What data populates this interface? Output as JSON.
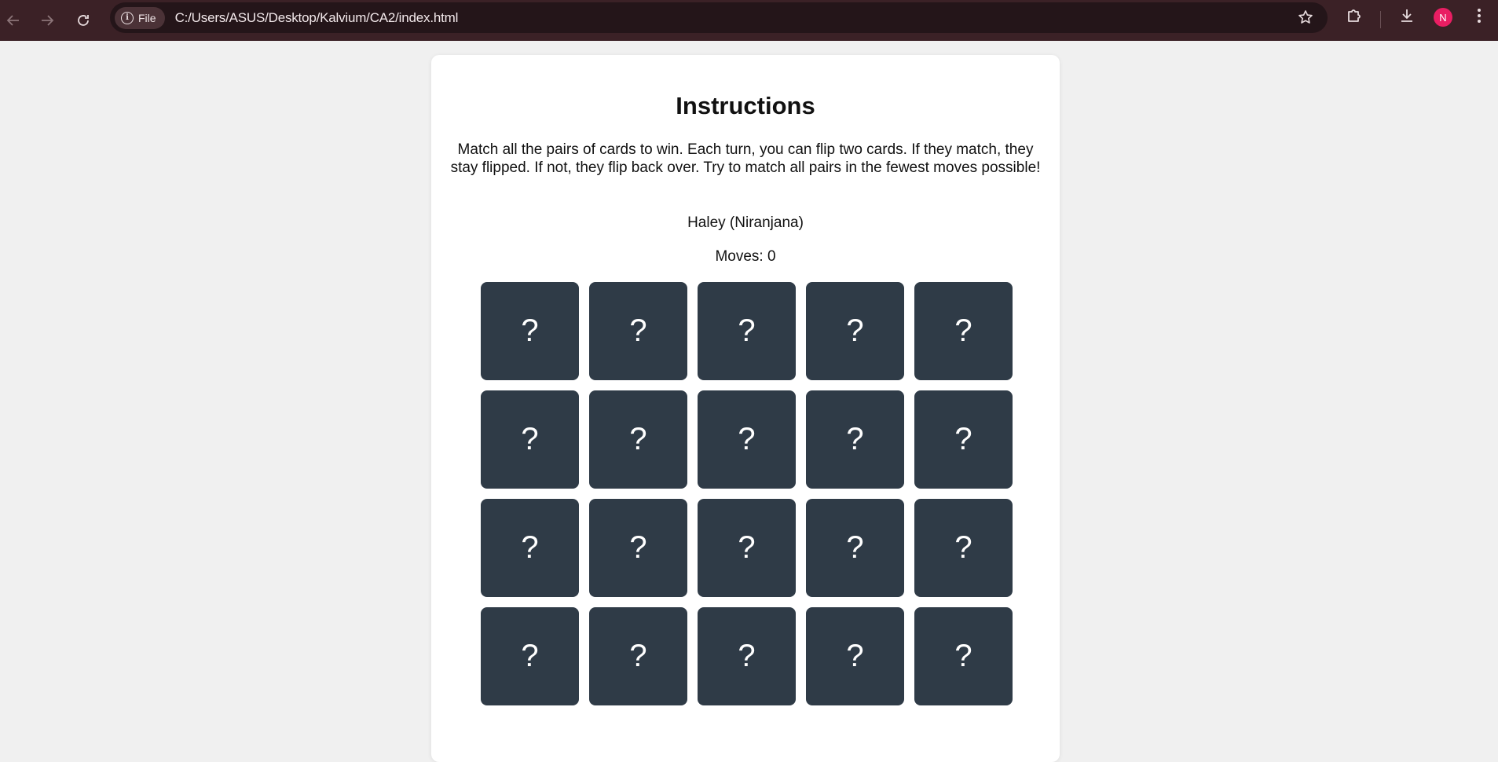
{
  "browser": {
    "chip_label": "File",
    "url": "C:/Users/ASUS/Desktop/Kalvium/CA2/index.html",
    "avatar_initial": "N",
    "toolbar_color": "#3b2126",
    "avatar_color": "#e91e63"
  },
  "page": {
    "title": "Instructions",
    "instructions": "Match all the pairs of cards to win. Each turn, you can flip two cards. If they match, they stay flipped. If not, they flip back over. Try to match all pairs in the fewest moves possible!",
    "player": "Haley (Niranjana)",
    "moves": "Moves: 0"
  },
  "board": {
    "card_color": "#2f3b47",
    "cards": [
      "?",
      "?",
      "?",
      "?",
      "?",
      "?",
      "?",
      "?",
      "?",
      "?",
      "?",
      "?",
      "?",
      "?",
      "?",
      "?",
      "?",
      "?",
      "?",
      "?"
    ]
  }
}
